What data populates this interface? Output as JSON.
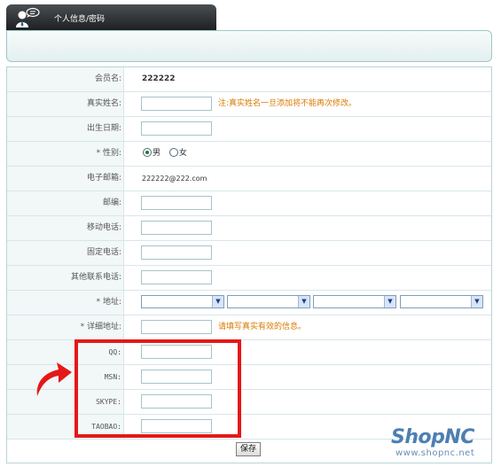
{
  "tab": {
    "title": "个人信息/密码",
    "icon": "user-info-icon"
  },
  "form": {
    "rows": [
      {
        "key": "member_name",
        "label": "会员名:",
        "value": "222222"
      },
      {
        "key": "real_name",
        "label": "真实姓名:",
        "value": "",
        "note": "注:真实姓名一旦添加将不能再次修改。"
      },
      {
        "key": "birthday",
        "label": "出生日期:",
        "value": ""
      },
      {
        "key": "gender",
        "label": "* 性别:",
        "options": [
          "男",
          "女"
        ],
        "selected": "男"
      },
      {
        "key": "email",
        "label": "电子邮箱:",
        "value": "222222@222.com"
      },
      {
        "key": "zip",
        "label": "邮编:",
        "value": ""
      },
      {
        "key": "mobile",
        "label": "移动电话:",
        "value": ""
      },
      {
        "key": "phone",
        "label": "固定电话:",
        "value": ""
      },
      {
        "key": "other_contact",
        "label": "其他联系电话:",
        "value": ""
      },
      {
        "key": "region",
        "label": "* 地址:",
        "selects": [
          "",
          "",
          "",
          ""
        ]
      },
      {
        "key": "address_detail",
        "label": "* 详细地址:",
        "value": "",
        "note": "请填写真实有效的信息。"
      },
      {
        "key": "qq",
        "label": "QQ:",
        "value": ""
      },
      {
        "key": "msn",
        "label": "MSN:",
        "value": ""
      },
      {
        "key": "skype",
        "label": "SKYPE:",
        "value": ""
      },
      {
        "key": "taobao",
        "label": "TAOBAO:",
        "value": ""
      }
    ],
    "save_label": "保存"
  },
  "watermark": {
    "brand": "ShopNC",
    "url": "www.shopnc.net"
  },
  "annotation": {
    "highlight_color": "#e51818"
  }
}
